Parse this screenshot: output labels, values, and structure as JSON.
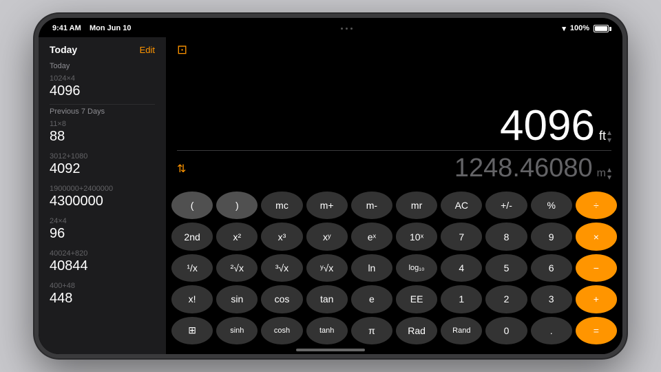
{
  "status_bar": {
    "time": "9:41 AM",
    "date": "Mon Jun 10",
    "wifi": "▾",
    "battery": "100%"
  },
  "sidebar": {
    "title": "Today",
    "edit_label": "Edit",
    "sections": [
      {
        "label": "Today",
        "items": [
          {
            "expr": "1024×4",
            "result": "4096"
          }
        ]
      },
      {
        "label": "Previous 7 Days",
        "items": [
          {
            "expr": "11×8",
            "result": "88"
          },
          {
            "expr": "3012+1080",
            "result": "4092"
          },
          {
            "expr": "1900000+2400000",
            "result": "4300000"
          },
          {
            "expr": "24×4",
            "result": "96"
          },
          {
            "expr": "40024+820",
            "result": "40844"
          },
          {
            "expr": "400+48",
            "result": "448"
          }
        ]
      }
    ]
  },
  "display": {
    "primary_value": "4096",
    "primary_unit": "ft",
    "secondary_value": "1248.46080",
    "secondary_unit": "m"
  },
  "buttons": [
    [
      "(",
      ")",
      "mc",
      "m+",
      "m-",
      "mr",
      "AC",
      "+/-",
      "%",
      "÷"
    ],
    [
      "2nd",
      "x²",
      "x³",
      "xʸ",
      "eˣ",
      "10ˣ",
      "7",
      "8",
      "9",
      "×"
    ],
    [
      "¹/x",
      "²√x",
      "³√x",
      "ʸ√x",
      "ln",
      "log₁₀",
      "4",
      "5",
      "6",
      "−"
    ],
    [
      "x!",
      "sin",
      "cos",
      "tan",
      "e",
      "EE",
      "1",
      "2",
      "3",
      "+"
    ],
    [
      "⊞",
      "sinh",
      "cosh",
      "tanh",
      "π",
      "Rad",
      "Rand",
      "0",
      ".",
      "="
    ]
  ],
  "button_types": [
    [
      "medium",
      "medium",
      "dark",
      "dark",
      "dark",
      "dark",
      "dark",
      "dark",
      "dark",
      "orange"
    ],
    [
      "dark",
      "dark",
      "dark",
      "dark",
      "dark",
      "dark",
      "dark",
      "dark",
      "dark",
      "orange"
    ],
    [
      "dark",
      "dark",
      "dark",
      "dark",
      "dark",
      "dark",
      "dark",
      "dark",
      "dark",
      "orange"
    ],
    [
      "dark",
      "dark",
      "dark",
      "dark",
      "dark",
      "dark",
      "dark",
      "dark",
      "dark",
      "orange"
    ],
    [
      "dark",
      "dark",
      "dark",
      "dark",
      "dark",
      "dark",
      "dark",
      "dark",
      "dark",
      "orange"
    ]
  ]
}
